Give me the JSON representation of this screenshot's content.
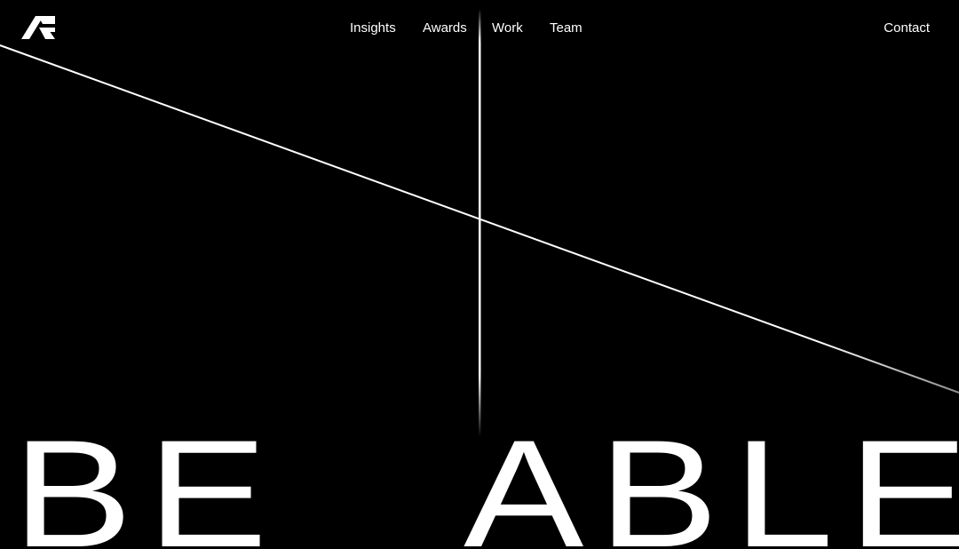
{
  "logo": {
    "icon": "brand-logo-icon"
  },
  "nav": {
    "items": [
      {
        "label": "Insights"
      },
      {
        "label": "Awards"
      },
      {
        "label": "Work"
      },
      {
        "label": "Team"
      }
    ],
    "contact_label": "Contact"
  },
  "hero": {
    "word_left": "BE",
    "word_right": "ABLE"
  },
  "colors": {
    "background": "#000000",
    "foreground": "#ffffff"
  }
}
